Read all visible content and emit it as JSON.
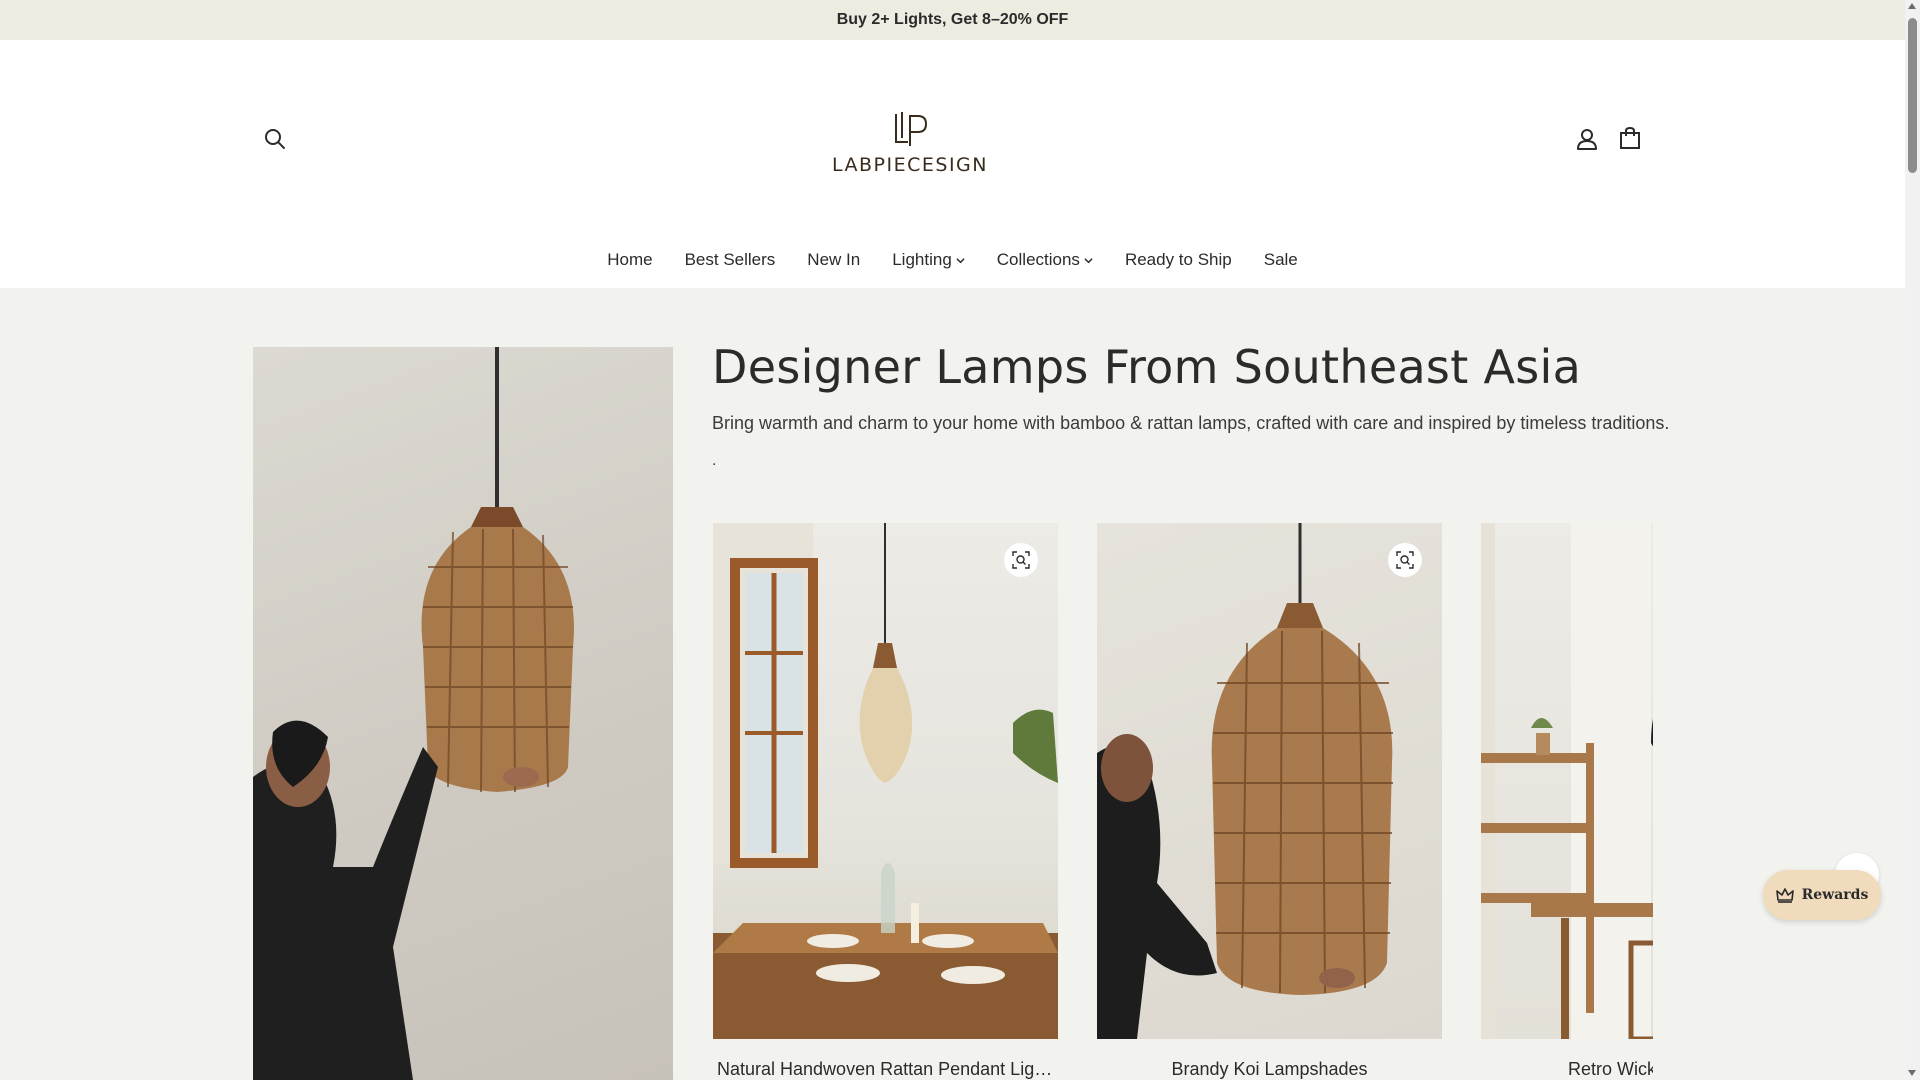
{
  "announcement": {
    "text": "Buy 2+ Lights, Get 8–20% OFF"
  },
  "header": {
    "logo_text": "LABPIECESIGN",
    "icons": {
      "search": "search-icon",
      "account": "user-icon",
      "cart": "shopping-bag-icon"
    }
  },
  "nav": {
    "items": [
      {
        "label": "Home",
        "has_dropdown": false
      },
      {
        "label": "Best Sellers",
        "has_dropdown": false
      },
      {
        "label": "New In",
        "has_dropdown": false
      },
      {
        "label": "Lighting",
        "has_dropdown": true
      },
      {
        "label": "Collections",
        "has_dropdown": true
      },
      {
        "label": "Ready to Ship",
        "has_dropdown": false
      },
      {
        "label": "Sale",
        "has_dropdown": false
      }
    ]
  },
  "collection": {
    "title": "Designer Lamps From Southeast Asia",
    "description": "Bring warmth and charm to your home with bamboo & rattan lamps, crafted with care and inspired by timeless traditions.",
    "trailing": "."
  },
  "products": [
    {
      "name": "Natural Handwoven Rattan Pendant Light f..."
    },
    {
      "name": "Brandy Koi Lampshades"
    },
    {
      "name": "Retro Wicker Pendan"
    }
  ],
  "rewards": {
    "label": "Rewards"
  },
  "colors": {
    "announcement_bg": "#eeebe0",
    "page_bg": "#f2f2ee",
    "text": "#2b2b2b",
    "rewards_bg": "#f0dcbc",
    "logo": "#3a2c1c"
  }
}
